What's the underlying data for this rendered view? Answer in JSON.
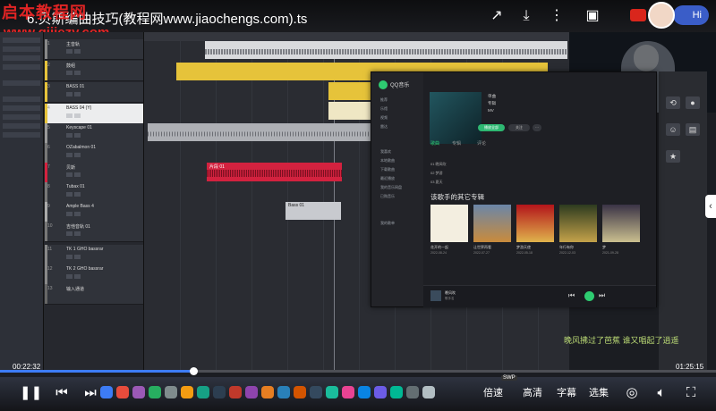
{
  "overlay": {
    "watermark_cn": "启本教程网",
    "watermark_url": "www.qijiezy.com",
    "video_title": "6.贝斯编曲技巧(教程网www.jiaochengs.com).ts",
    "hi_label": "Hi"
  },
  "daw": {
    "tracks": [
      {
        "num": "1",
        "name": "主音轨"
      },
      {
        "num": "2",
        "name": "鼓组"
      },
      {
        "num": "3",
        "name": "BASS 01"
      },
      {
        "num": "4",
        "name": "BASS 04 (Y)"
      },
      {
        "num": "5",
        "name": "Keyscape 01"
      },
      {
        "num": "6",
        "name": "OZabalmon 01"
      },
      {
        "num": "7",
        "name": "贝斯"
      },
      {
        "num": "8",
        "name": "Tubax 01"
      },
      {
        "num": "9",
        "name": "Ample Bass 4"
      },
      {
        "num": "10",
        "name": "吉他音轨 01"
      },
      {
        "num": "11",
        "name": "TK 1 GHO bassrar"
      },
      {
        "num": "12",
        "name": "TK 2 GHO bassrar"
      },
      {
        "num": "13",
        "name": "输入通道"
      }
    ],
    "clip_names": [
      "片段 01",
      "片段 02",
      "贝斯 01",
      "Bass 01"
    ]
  },
  "qq": {
    "app_name": "QQ音乐",
    "nav": [
      "推荐",
      "乐馆",
      "视频",
      "雷达",
      "我喜欢",
      "本地歌曲",
      "下载歌曲",
      "最近播放",
      "我的音乐网盘",
      "已购音乐",
      "我的歌单"
    ],
    "artist_lines": [
      "单曲",
      "专辑",
      "MV"
    ],
    "play_all": "播放全部",
    "follow": "关注",
    "tabs": [
      "歌曲",
      "专辑",
      "评论"
    ],
    "rows": [
      "01 晚风吹",
      "02 梦游",
      "03 夏天"
    ],
    "section_title": "该歌手的其它专辑",
    "albums": [
      {
        "name": "花开的一起",
        "date": "2022-08-24"
      },
      {
        "name": "让世界再看",
        "date": "2022-07-27"
      },
      {
        "name": "梦游天使",
        "date": "2022-05-18"
      },
      {
        "name": "年行有你",
        "date": "2022-12-03"
      },
      {
        "name": "梦",
        "date": "2021-09-28"
      }
    ],
    "now_playing": "晚风吹",
    "now_artist": "歌手名"
  },
  "lyric": "晚风拂过了芭蕉 谁又唱起了逍遥",
  "transport": {
    "current_time": "00:22:32",
    "total_time": "01:25:15",
    "progress": 0.27
  },
  "controls": {
    "speed": "倍速",
    "quality": "高清",
    "subtitle": "字幕",
    "episodes": "选集",
    "swp": "SWP"
  },
  "colors": {
    "accent_green": "#2ecc71",
    "watermark_red": "#e02424",
    "clip_yellow": "#e6c33a",
    "clip_red": "#d3223f",
    "progress_blue": "#3d7cf5"
  }
}
